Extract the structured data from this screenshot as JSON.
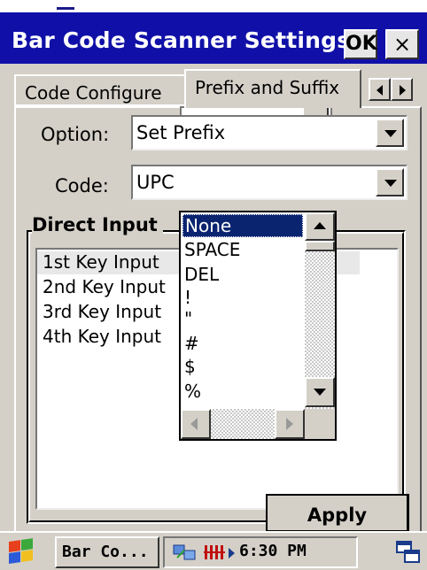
{
  "window": {
    "title": "Bar Code Scanner Settings",
    "ok_label": "OK",
    "close_label": "×"
  },
  "tabs": [
    {
      "label": "Code Configure",
      "active": false
    },
    {
      "label": "Prefix and Suffix",
      "active": true
    }
  ],
  "form": {
    "option_label": "Option:",
    "option_value": "Set Prefix",
    "code_label": "Code:",
    "code_value": "UPC"
  },
  "direct_input": {
    "title": "Direct Input",
    "items": [
      "1st  Key Input",
      "2nd Key Input",
      "3rd Key Input",
      "4th Key Input"
    ]
  },
  "dropdown": {
    "items": [
      "None",
      "SPACE",
      "DEL",
      "!",
      "\"",
      "#",
      "$",
      "%"
    ],
    "selected": "None"
  },
  "apply_label": "Apply",
  "taskbar": {
    "task_label": "Bar Co...",
    "clock": "6:30 PM"
  },
  "colors": {
    "titlebar": "#1010a8",
    "selection": "#0a2470",
    "face": "#d4d0c8"
  }
}
